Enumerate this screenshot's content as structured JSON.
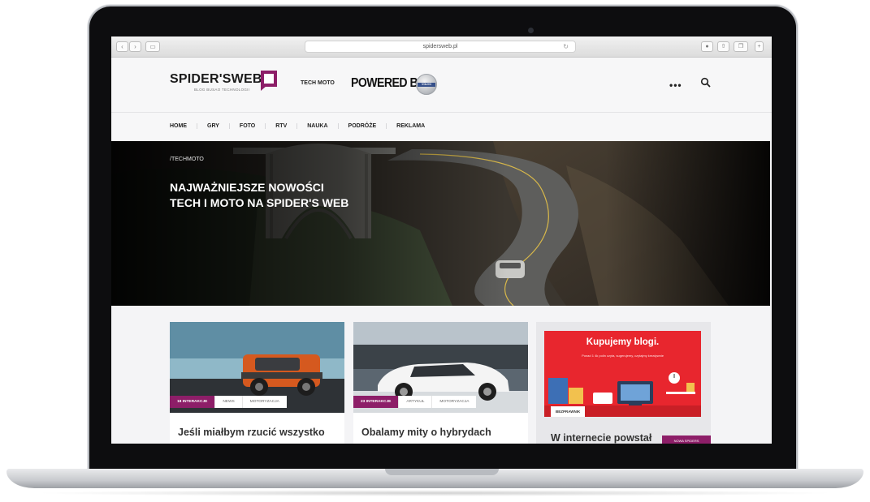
{
  "browser": {
    "url": "spidersweb.pl"
  },
  "header": {
    "logo_text": "SPIDER'SWEB",
    "logo_tagline": "BLOG BUSAO TECHNOLOGII",
    "tech_moto": "TECH MOTO",
    "powered_by": "POWERED BY",
    "volvo_label": "VOLVO",
    "more_label": "•••"
  },
  "nav": {
    "items": [
      "HOME",
      "GRY",
      "FOTO",
      "RTV",
      "NAUKA",
      "PODRÓŻE",
      "REKLAMA"
    ]
  },
  "hero": {
    "label": "/TECHMOTO",
    "title": "NAJWAŻNIEJSZE NOWOŚCI TECH I MOTO NA SPIDER'S WEB"
  },
  "cards": [
    {
      "badge": "18 INTERAKCJE",
      "tags": [
        "NEWS",
        "MOTORYZACJA"
      ],
      "title": "Jeśli miałbym rzucić wszystko"
    },
    {
      "badge": "23 INTERAKCJE",
      "tags": [
        "ARTYKUŁ",
        "MOTORYZACJA"
      ],
      "title": "Obalamy mity o hybrydach"
    }
  ],
  "promo": {
    "title": "Kupujemy blogi.",
    "subtitle": "Ponad 1 4k polin\nczyta, sugerujemy, czytajmy kreatywnie",
    "badge": "BEZPRAWNIK",
    "text": "W internecie powstał",
    "tag": "NOWA SPIDERS"
  },
  "colors": {
    "brand": "#8d1e68",
    "promo_red": "#e8262e"
  }
}
